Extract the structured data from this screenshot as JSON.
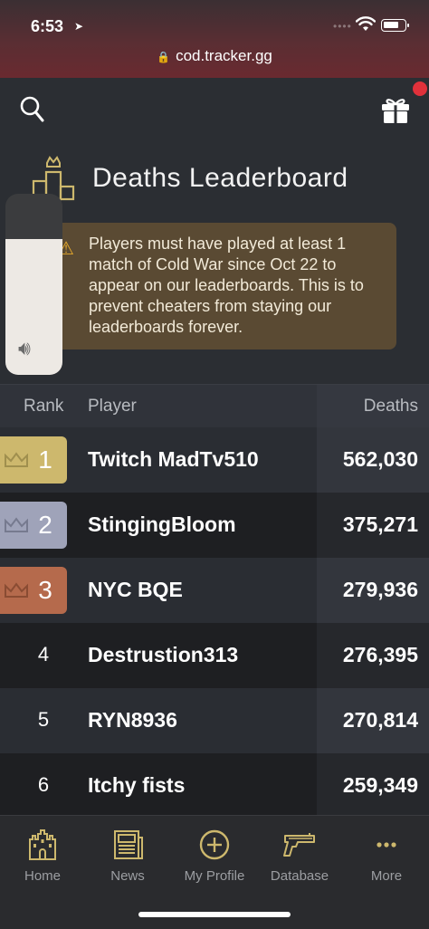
{
  "status_bar": {
    "time": "6:53",
    "url": "cod.tracker.gg"
  },
  "header": {
    "title": "Deaths Leaderboard"
  },
  "notice": {
    "text": "Players must have played at least 1 match of Cold War since Oct 22 to appear on our leaderboards. This is to prevent cheaters from staying our leaderboards forever."
  },
  "volume": {
    "level": 0.75
  },
  "table": {
    "columns": {
      "rank": "Rank",
      "player": "Player",
      "deaths": "Deaths"
    },
    "rows": [
      {
        "rank": "1",
        "player": "Twitch MadTv510",
        "deaths": "562,030"
      },
      {
        "rank": "2",
        "player": "StingingBloom",
        "deaths": "375,271"
      },
      {
        "rank": "3",
        "player": "NYC BQE",
        "deaths": "279,936"
      },
      {
        "rank": "4",
        "player": "Destrustion313",
        "deaths": "276,395"
      },
      {
        "rank": "5",
        "player": "RYN8936",
        "deaths": "270,814"
      },
      {
        "rank": "6",
        "player": "Itchy fists",
        "deaths": "259,349"
      }
    ]
  },
  "nav": [
    {
      "label": "Home",
      "icon": "castle-icon"
    },
    {
      "label": "News",
      "icon": "newspaper-icon"
    },
    {
      "label": "My Profile",
      "icon": "plus-circle-icon"
    },
    {
      "label": "Database",
      "icon": "gun-icon"
    },
    {
      "label": "More",
      "icon": "more-icon"
    }
  ],
  "colors": {
    "gold": "#cdb86d",
    "silver": "#9fa3b9",
    "bronze": "#b56a4c",
    "nav_icon": "#cdb86d",
    "notice_bg": "#5a4a33",
    "alert_dot": "#e0313b"
  }
}
